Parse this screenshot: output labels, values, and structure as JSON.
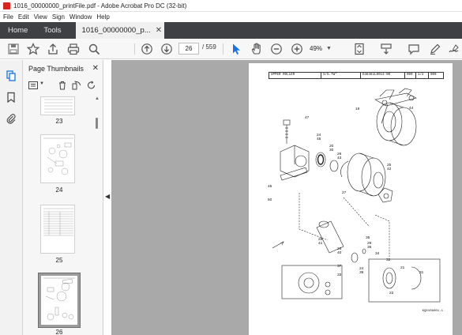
{
  "window": {
    "title": "1016_00000000_printFile.pdf - Adobe Acrobat Pro DC (32-bit)"
  },
  "menu": [
    "File",
    "Edit",
    "View",
    "Sign",
    "Window",
    "Help"
  ],
  "tabs": {
    "home": "Home",
    "tools": "Tools",
    "document": "1016_00000000_p..."
  },
  "toolbar": {
    "current_page": "26",
    "page_total": "/ 559",
    "zoom": "49%"
  },
  "thumbnails": {
    "title": "Page Thumbnails",
    "pages": [
      {
        "label": "23"
      },
      {
        "label": "24"
      },
      {
        "label": "25"
      },
      {
        "label": "26",
        "selected": true
      }
    ]
  },
  "document": {
    "header": {
      "part_name": "UPPER ROLLER",
      "scale": "S/5.7W*",
      "drawing_no": "D48481L0014-00",
      "code": "000",
      "sheet": "1/2",
      "rev": "000"
    },
    "footer_code": "KQ01RA001-1",
    "callouts": [
      "19",
      "47",
      "24",
      "45",
      "20",
      "30",
      "26",
      "43",
      "44",
      "25",
      "42",
      "46",
      "50",
      "27",
      "35",
      "28",
      "41",
      "23",
      "40",
      "29",
      "36",
      "24",
      "39",
      "34",
      "37",
      "33",
      "32",
      "21",
      "31",
      "22"
    ]
  },
  "colors": {
    "tabbar_bg": "#3f4043",
    "doc_area_bg": "#a9a9a9",
    "select_blue": "#1473e6",
    "acrobat_red": "#d8231f"
  }
}
